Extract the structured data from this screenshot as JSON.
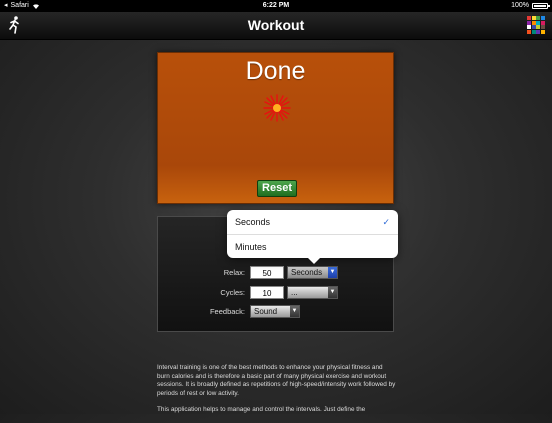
{
  "status_bar": {
    "carrier": "Safari",
    "time": "6:22 PM",
    "battery": "100%"
  },
  "nav": {
    "title": "Workout",
    "left_icon": "runner-icon",
    "right_icon": "color-palette-icon",
    "palette_colors": [
      "#e53935",
      "#fdd835",
      "#43a047",
      "#1e88e5",
      "#8e24aa",
      "#fb8c00",
      "#00acc1",
      "#d81b60",
      "#ffffff",
      "#3949ab",
      "#c0ca33",
      "#6d4c41",
      "#f4511e",
      "#00897b",
      "#5e35b1",
      "#ffb300"
    ]
  },
  "timer_panel": {
    "status": "Done",
    "reset_label": "Reset",
    "background_color": "#b14e0a"
  },
  "settings": {
    "relax": {
      "label": "Relax:",
      "value": "50",
      "unit": "Seconds"
    },
    "cycles": {
      "label": "Cycles:",
      "value": "10",
      "unit": "..."
    },
    "feedback": {
      "label": "Feedback:",
      "value": "Sound"
    }
  },
  "unit_popover": {
    "options": [
      {
        "label": "Seconds",
        "selected": true,
        "check": "✓"
      },
      {
        "label": "Minutes",
        "selected": false
      }
    ]
  },
  "description": {
    "p1": "Interval training is one of the best methods to enhance your physical fitness and burn calories and is therefore a basic part of many physical exercise and workout sessions. It is broadly defined as repetitions of high-speed/intensity work followed by periods of rest or low activity.",
    "p2": "This application helps to manage and control the intervals. Just define the"
  }
}
